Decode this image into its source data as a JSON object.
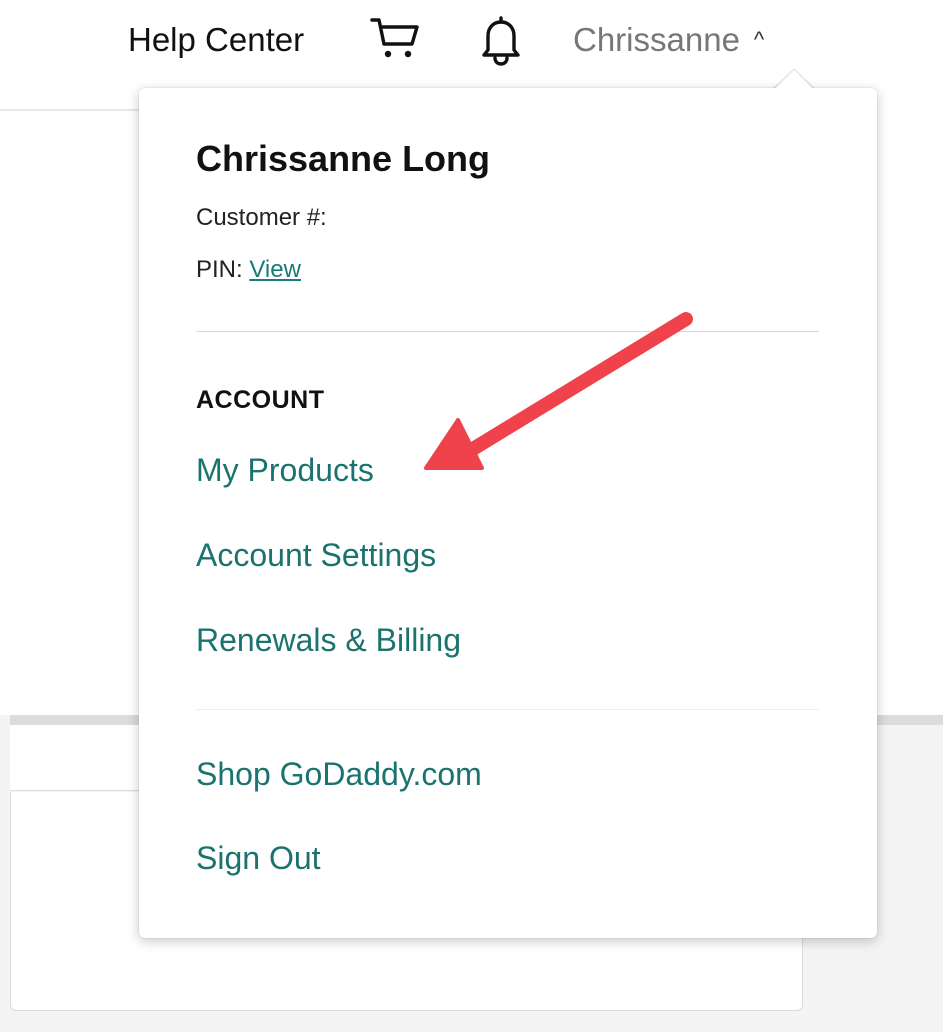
{
  "nav": {
    "help_label": "Help Center",
    "cart_icon": "shopping-cart-icon",
    "bell_icon": "bell-icon",
    "user_label": "Chrissanne",
    "caret": "^"
  },
  "menu": {
    "full_name": "Chrissanne Long",
    "customer_label": "Customer #:",
    "pin_label": "PIN:",
    "pin_link": "View",
    "section_heading": "ACCOUNT",
    "account_links": [
      {
        "label": "My Products"
      },
      {
        "label": "Account Settings"
      },
      {
        "label": "Renewals & Billing"
      }
    ],
    "footer_links": [
      {
        "label": "Shop GoDaddy.com"
      },
      {
        "label": "Sign Out"
      }
    ]
  },
  "annotation": {
    "arrow_color": "#f0424a",
    "target": "My Products"
  },
  "colors": {
    "link": "#1b7370",
    "text": "#111111",
    "muted": "#777777"
  }
}
